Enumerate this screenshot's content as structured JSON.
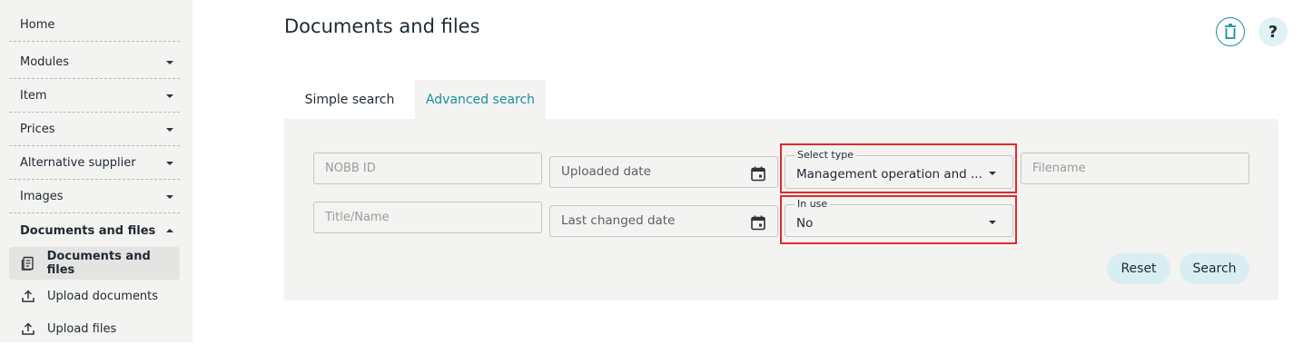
{
  "sidebar": {
    "items": [
      {
        "label": "Home"
      },
      {
        "label": "Modules"
      },
      {
        "label": "Item"
      },
      {
        "label": "Prices"
      },
      {
        "label": "Alternative supplier"
      },
      {
        "label": "Images"
      },
      {
        "label": "Documents and files"
      }
    ],
    "subitems": [
      {
        "label": "Documents and files",
        "icon": "document-icon",
        "active": true
      },
      {
        "label": "Upload documents",
        "icon": "upload-icon"
      },
      {
        "label": "Upload files",
        "icon": "upload-icon"
      }
    ]
  },
  "header": {
    "title": "Documents and files",
    "help_label": "?"
  },
  "tabs": [
    {
      "label": "Simple search"
    },
    {
      "label": "Advanced search",
      "active": true
    }
  ],
  "form": {
    "nobb_id_placeholder": "NOBB ID",
    "uploaded_date_placeholder": "Uploaded date",
    "select_type": {
      "label": "Select type",
      "value": "Management operation and ..."
    },
    "filename_placeholder": "Filename",
    "title_name_placeholder": "Title/Name",
    "last_changed_date_placeholder": "Last changed date",
    "in_use": {
      "label": "In use",
      "value": "No"
    }
  },
  "actions": {
    "reset_label": "Reset",
    "search_label": "Search"
  },
  "colors": {
    "accent": "#1a8fa0",
    "sidebar_bg": "#f3f3f1",
    "highlight": "#e02b2b",
    "button_bg": "#d9eef2"
  }
}
